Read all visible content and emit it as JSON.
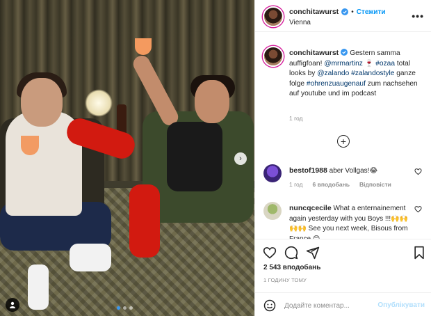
{
  "header": {
    "username": "conchitawurst",
    "separator": "•",
    "follow_label": "Стежити",
    "location": "Vienna",
    "more_label": "•••"
  },
  "caption": {
    "username": "conchitawurst",
    "text_1": "Gestern samma auffigfoan! ",
    "mention_1": "@mrmartinz",
    "text_2": " ",
    "emoji_1": "🍷",
    "text_3": " ",
    "hashtag_1": "#ozaa",
    "text_4": " total looks by ",
    "mention_2": "@zalando",
    "text_5": " ",
    "hashtag_2": "#zalandostyle",
    "text_6": " ganze folge ",
    "hashtag_3": "#ohrenzuaugenauf",
    "text_7": " zum nachsehen auf youtube und im podcast",
    "time": "1 год"
  },
  "load_more_label": "+",
  "comments": [
    {
      "username": "bestof1988",
      "text": " aber Vollgas!😂",
      "time": "1 год",
      "likes": "6 вподобань",
      "reply": "Відповісти"
    },
    {
      "username": "nuncqcecile",
      "text": " What a enternainement again yesterday with you Boys !!!🙌🙌🙌🙌 See you next week, Bisous from France 😊"
    }
  ],
  "post": {
    "likes": "2 543 вподобань",
    "time": "1 ГОДИНУ ТОМУ"
  },
  "comment_box": {
    "placeholder": "Додайте коментар...",
    "post_label": "Опублікувати"
  },
  "carousel": {
    "next_label": "›",
    "slide_count": 3,
    "active_slide": 1
  },
  "colors": {
    "accent": "#0095f6",
    "post_disabled": "#b2dffc",
    "secondary_text": "#8e8e8e",
    "link": "#00376b"
  }
}
